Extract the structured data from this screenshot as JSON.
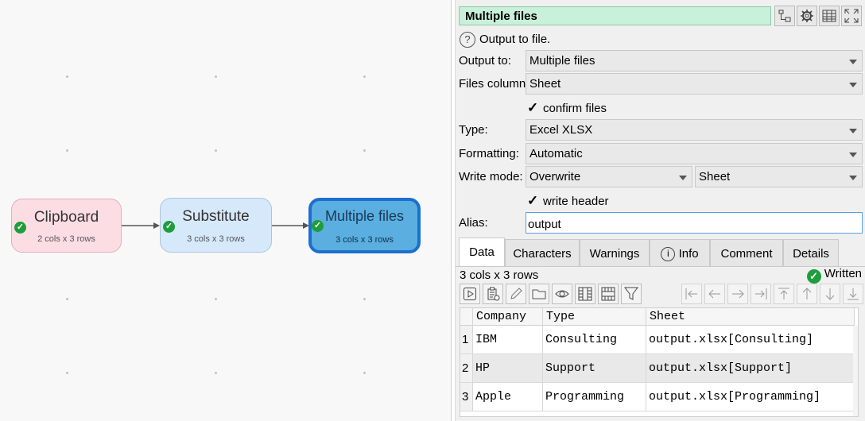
{
  "canvas": {
    "nodes": [
      {
        "title": "Clipboard",
        "subtitle": "2 cols x 3 rows",
        "status": "ok",
        "color": "#fddde4"
      },
      {
        "title": "Substitute",
        "subtitle": "3 cols x 3 rows",
        "status": "ok",
        "color": "#d6e9fb"
      },
      {
        "title": "Multiple files",
        "subtitle": "3 cols x 3 rows",
        "status": "ok",
        "selected": true,
        "color": "#5aaee0"
      }
    ]
  },
  "panel": {
    "title": "Multiple files",
    "title_color": "#c9f0d8",
    "toolbar_icons": [
      "connections-icon",
      "gear-icon",
      "table-icon",
      "expand-icon"
    ],
    "help_text": "Output to file.",
    "fields": {
      "output_to": {
        "label": "Output to:",
        "value": "Multiple files"
      },
      "files_column": {
        "label": "Files column:",
        "value": "Sheet"
      },
      "confirm_files": {
        "label": "confirm files",
        "checked": true
      },
      "type": {
        "label": "Type:",
        "value": "Excel XLSX"
      },
      "formatting": {
        "label": "Formatting:",
        "value": "Automatic"
      },
      "write_mode": {
        "label": "Write mode:",
        "value": "Overwrite",
        "value2": "Sheet"
      },
      "write_header": {
        "label": "write header",
        "checked": true
      },
      "alias": {
        "label": "Alias:",
        "value": "output"
      }
    },
    "tabs": [
      "Data",
      "Characters",
      "Warnings",
      "Info",
      "Comment",
      "Details"
    ],
    "active_tab": "Data",
    "data": {
      "row_info": "3 cols x 3 rows",
      "status": "Written",
      "columns": [
        "Company",
        "Type",
        "Sheet"
      ],
      "rows": [
        {
          "num": "1",
          "cells": [
            "IBM",
            "Consulting",
            "output.xlsx[Consulting]"
          ]
        },
        {
          "num": "2",
          "cells": [
            "HP",
            "Support",
            "output.xlsx[Support]"
          ]
        },
        {
          "num": "3",
          "cells": [
            "Apple",
            "Programming",
            "output.xlsx[Programming]"
          ]
        }
      ],
      "tool_icons": [
        "run-icon",
        "paste-icon",
        "edit-icon",
        "folder-icon",
        "eye-icon",
        "columns-icon",
        "rows-icon",
        "filter-icon",
        "first-col-icon",
        "left-icon",
        "right-icon",
        "last-col-icon",
        "top-icon",
        "up-icon",
        "down-icon",
        "bottom-icon"
      ]
    }
  }
}
